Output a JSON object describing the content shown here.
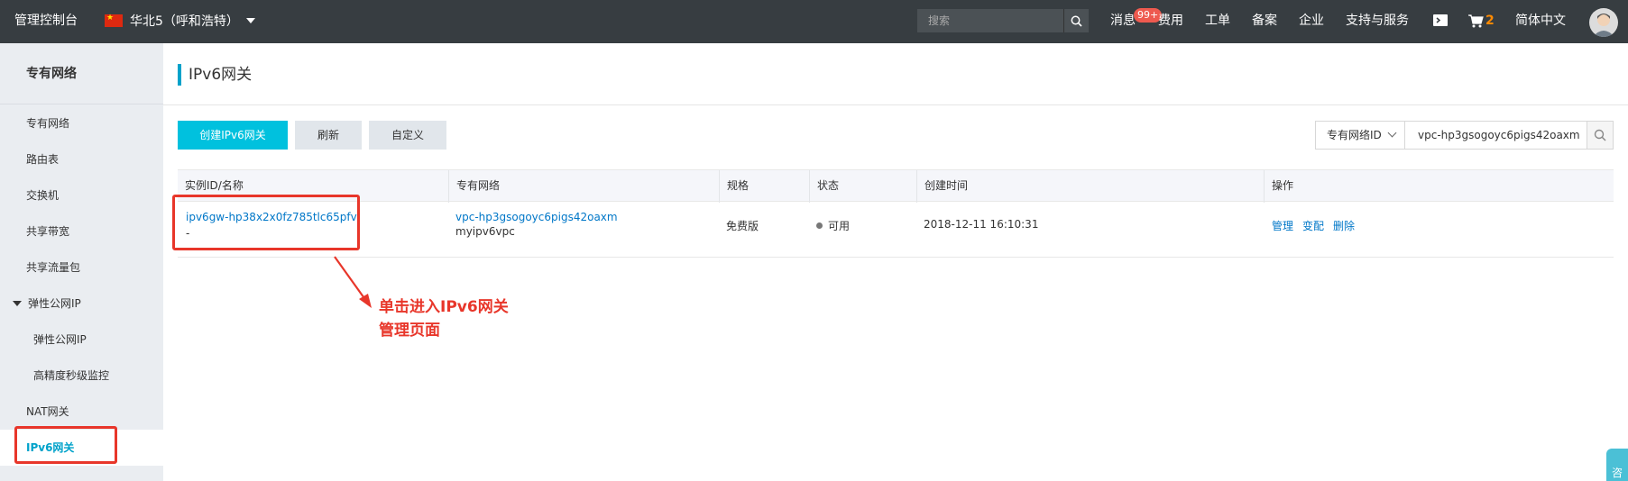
{
  "topbar": {
    "brand": "管理控制台",
    "region": "华北5（呼和浩特）",
    "search_placeholder": "搜索",
    "messages": "消息",
    "messages_badge": "99+",
    "billing": "费用",
    "tickets": "工单",
    "icp": "备案",
    "enterprise": "企业",
    "support": "支持与服务",
    "cart_count": "2",
    "language": "简体中文"
  },
  "sidebar": {
    "title": "专有网络",
    "items": [
      {
        "label": "专有网络"
      },
      {
        "label": "路由表"
      },
      {
        "label": "交换机"
      },
      {
        "label": "共享带宽"
      },
      {
        "label": "共享流量包"
      },
      {
        "label": "弹性公网IP"
      },
      {
        "label": "弹性公网IP"
      },
      {
        "label": "高精度秒级监控"
      },
      {
        "label": "NAT网关"
      },
      {
        "label": "IPv6网关"
      }
    ]
  },
  "page": {
    "title": "IPv6网关"
  },
  "toolbar": {
    "create_label": "创建IPv6网关",
    "refresh_label": "刷新",
    "custom_label": "自定义",
    "filter_field": "专有网络ID",
    "filter_value": "vpc-hp3gsogoyc6pigs42oaxm"
  },
  "table": {
    "headers": [
      "实例ID/名称",
      "专有网络",
      "规格",
      "状态",
      "创建时间",
      "操作"
    ],
    "rows": [
      {
        "instance_id": "ipv6gw-hp38x2x0fz785tlc65pfv",
        "instance_name": "-",
        "vpc_id": "vpc-hp3gsogoyc6pigs42oaxm",
        "vpc_name": "myipv6vpc",
        "spec": "免费版",
        "status": "可用",
        "created": "2018-12-11 16:10:31",
        "actions": [
          "管理",
          "变配",
          "删除"
        ]
      }
    ]
  },
  "annotation": {
    "line1": "单击进入IPv6网关",
    "line2": "管理页面"
  },
  "float_tab": "咨",
  "colors": {
    "topbar_bg": "#373d41",
    "accent": "#00c1de",
    "link": "#0077c8",
    "annotation": "#e8362a"
  }
}
